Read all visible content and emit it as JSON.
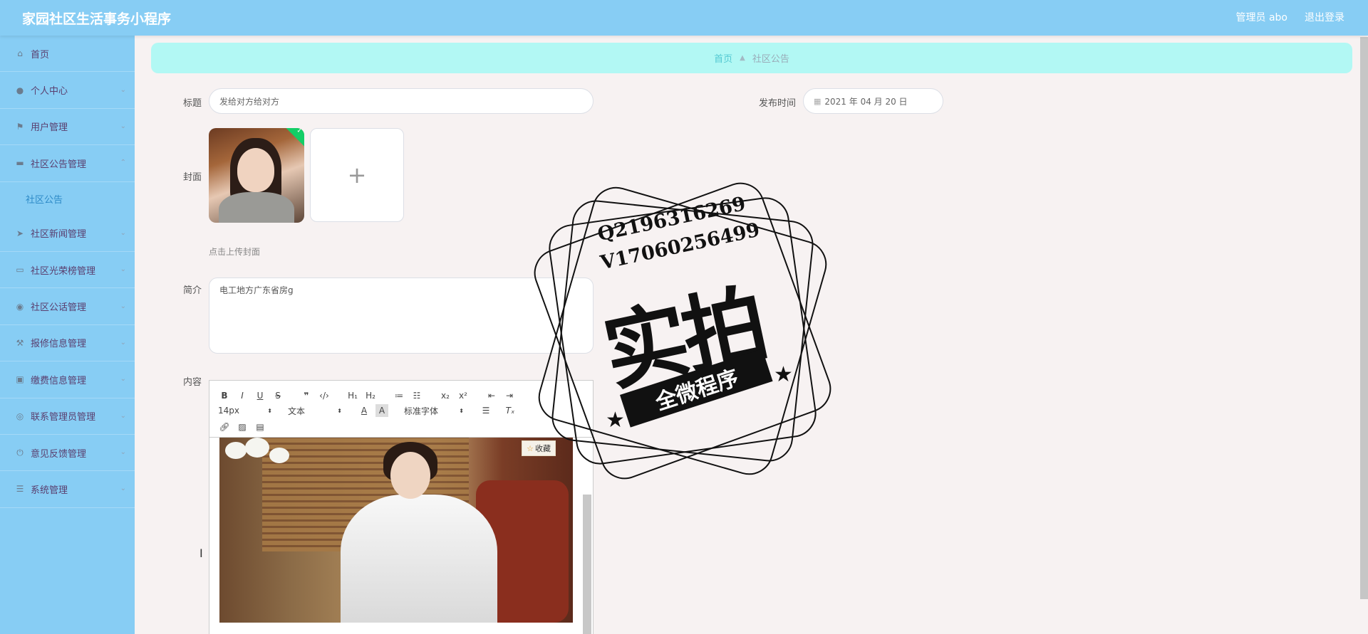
{
  "header": {
    "title": "家园社区生活事务小程序",
    "user": "管理员 abo",
    "logout": "退出登录"
  },
  "sidebar": {
    "items": [
      {
        "label": "首页",
        "icon": "home-icon"
      },
      {
        "label": "个人中心",
        "icon": "user-icon"
      },
      {
        "label": "用户管理",
        "icon": "flag-icon"
      },
      {
        "label": "社区公告管理",
        "icon": "message-icon"
      },
      {
        "label": "社区新闻管理",
        "icon": "send-icon"
      },
      {
        "label": "社区光荣榜管理",
        "icon": "chat-icon"
      },
      {
        "label": "社区公话管理",
        "icon": "location-icon"
      },
      {
        "label": "报修信息管理",
        "icon": "tool-icon"
      },
      {
        "label": "缴费信息管理",
        "icon": "briefcase-icon"
      },
      {
        "label": "联系管理员管理",
        "icon": "compass-icon"
      },
      {
        "label": "意见反馈管理",
        "icon": "power-icon"
      },
      {
        "label": "系统管理",
        "icon": "menu-icon"
      }
    ],
    "sub_item": "社区公告"
  },
  "breadcrumb": {
    "home": "首页",
    "current": "社区公告"
  },
  "form": {
    "title_label": "标题",
    "title_value": "发给对方给对方",
    "time_label": "发布时间",
    "time_value": "2021 年 04 月 20 日",
    "cover_label": "封面",
    "upload_plus": "+",
    "cover_hint": "点击上传封面",
    "intro_label": "简介",
    "intro_value": "电工地方广东省房g",
    "content_label": "内容"
  },
  "editor": {
    "font_size": "14px",
    "text_type": "文本",
    "font_family": "标准字体",
    "fav_label": "收藏"
  },
  "watermark": {
    "qq": "Q2196316269",
    "vx": "V17060256499",
    "big": "实拍",
    "ribbon": "全微程序"
  }
}
